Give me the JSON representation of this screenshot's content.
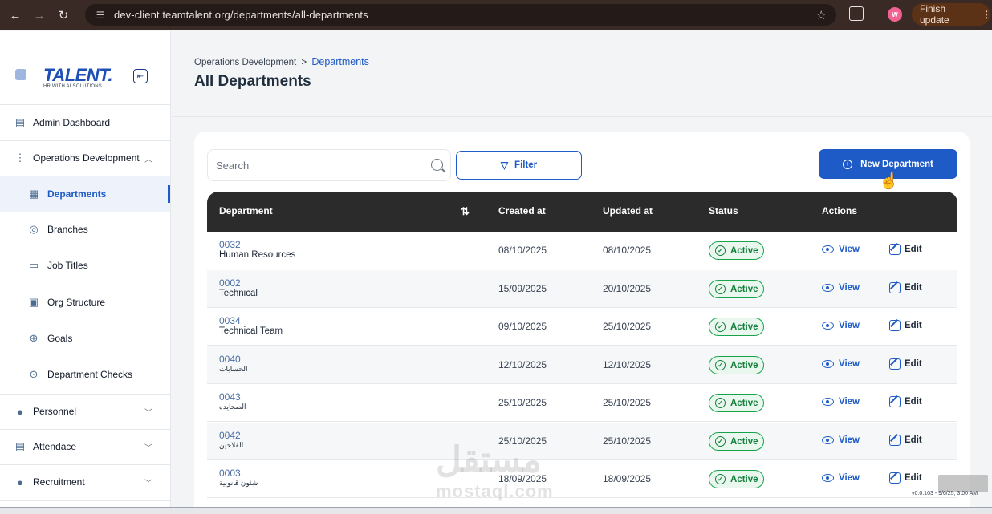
{
  "browser": {
    "url": "dev-client.teamtalent.org/departments/all-departments",
    "profile_initial": "W",
    "finish_update_label": "Finish update"
  },
  "sidebar": {
    "logo": "TALENT.",
    "logo_sub": "HR WITH AI SOLUTIONS",
    "items": [
      {
        "label": "Admin Dashboard"
      },
      {
        "label": "Operations Development"
      },
      {
        "label": "Departments"
      },
      {
        "label": "Branches"
      },
      {
        "label": "Job Titles"
      },
      {
        "label": "Org Structure"
      },
      {
        "label": "Goals"
      },
      {
        "label": "Department Checks"
      },
      {
        "label": "Personnel"
      },
      {
        "label": "Attendace"
      },
      {
        "label": "Recruitment"
      }
    ]
  },
  "breadcrumb": {
    "parent": "Operations Development",
    "separator": ">",
    "current": "Departments"
  },
  "page_title": "All Departments",
  "toolbar": {
    "search_placeholder": "Search",
    "filter_label": "Filter",
    "new_department_label": "New Department"
  },
  "table": {
    "columns": [
      "Department",
      "Created at",
      "Updated at",
      "Status",
      "Actions"
    ],
    "view_label": "View",
    "edit_label": "Edit",
    "rows": [
      {
        "code": "0032",
        "name": "Human Resources",
        "created": "08/10/2025",
        "updated": "08/10/2025",
        "status": "Active"
      },
      {
        "code": "0002",
        "name": "Technical",
        "created": "15/09/2025",
        "updated": "20/10/2025",
        "status": "Active"
      },
      {
        "code": "0034",
        "name": "Technical Team",
        "created": "09/10/2025",
        "updated": "25/10/2025",
        "status": "Active"
      },
      {
        "code": "0040",
        "name": "الحسابات",
        "created": "12/10/2025",
        "updated": "12/10/2025",
        "status": "Active"
      },
      {
        "code": "0043",
        "name": "الصحايده",
        "created": "25/10/2025",
        "updated": "25/10/2025",
        "status": "Active"
      },
      {
        "code": "0042",
        "name": "الفلاحين",
        "created": "25/10/2025",
        "updated": "25/10/2025",
        "status": "Active"
      },
      {
        "code": "0003",
        "name": "شئون قانونية",
        "created": "18/09/2025",
        "updated": "18/09/2025",
        "status": "Active"
      }
    ]
  },
  "watermark": {
    "text": "مستقل",
    "sub": "mostaql.com"
  },
  "version": "v0.0.103 - 9/6/25, 3:00 AM",
  "colors": {
    "accent": "#1e5bc6",
    "header_dark": "#2b2b2b",
    "active_green": "#15803d"
  }
}
